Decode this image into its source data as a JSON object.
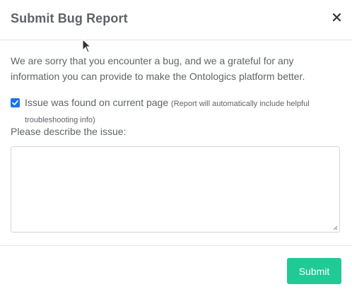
{
  "modal": {
    "title": "Submit Bug Report",
    "close_icon": "close-icon"
  },
  "body": {
    "intro_text": "We are sorry that you encounter a bug, and we a grateful for any information you can provide to make the Ontologics platform better.",
    "checkbox": {
      "checked": true,
      "label": "Issue was found on current page",
      "hint": "(Report will automatically include helpful troubleshooting info)"
    },
    "describe_label": "Please describe the issue:",
    "textarea_value": ""
  },
  "footer": {
    "submit_label": "Submit"
  },
  "colors": {
    "title": "#5f6368",
    "accent": "#21c995",
    "checkbox": "#1a73e8",
    "border": "#e6e6e6"
  }
}
